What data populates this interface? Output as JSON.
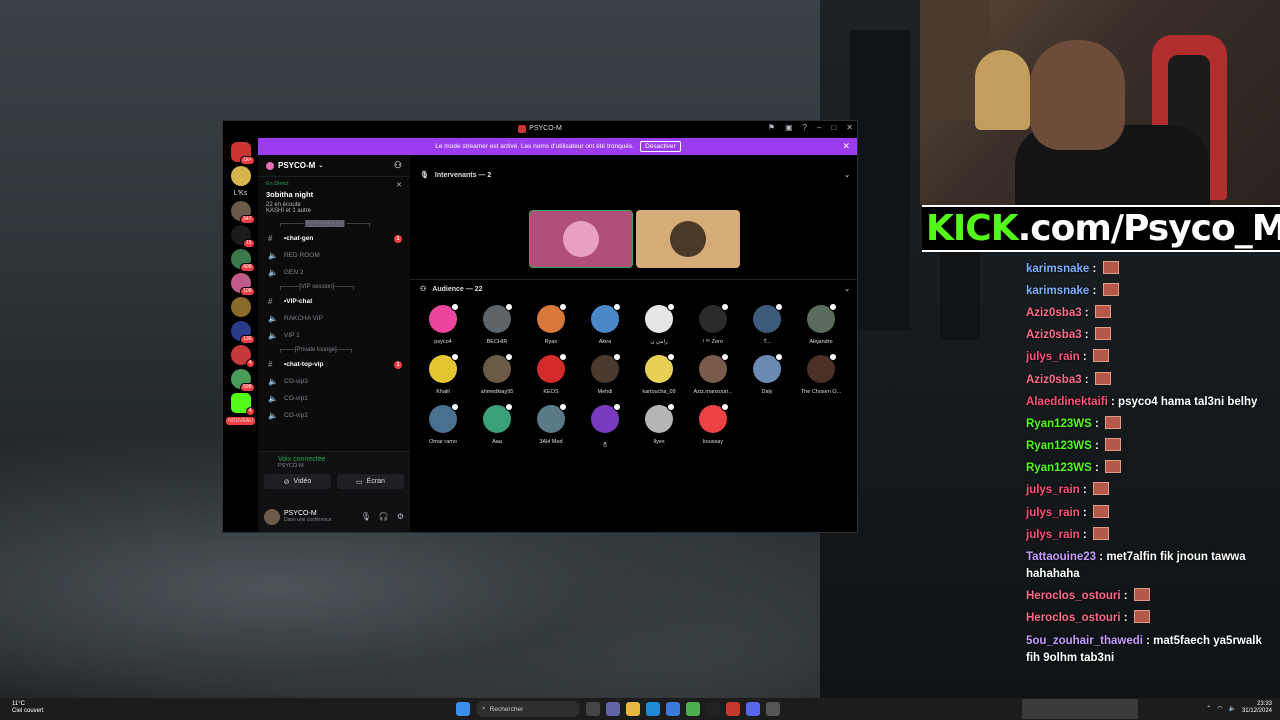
{
  "window": {
    "title": "PSYCO-M",
    "banner_text": "Le mode streamer est activé. Les noms d'utilisateur ont été tronqués.",
    "banner_button": "Désactiver"
  },
  "rail": {
    "lks_label": "L'Ks",
    "new_label": "NOUVEAU",
    "badges": [
      "1k+",
      "347",
      "15",
      "408",
      "108",
      "136",
      "4",
      "598",
      "4"
    ]
  },
  "server": {
    "name": "PSYCO-M",
    "event_live": "En Direct",
    "event_name": "3obitha night",
    "event_sub": "22 en écoute",
    "event_users": "KASHI et 1 autre",
    "categories": [
      {
        "label": "┌───── ▓▓▓▓▓▓▓▓▓ ─────┐",
        "channels": [
          {
            "icon": "#",
            "label": "•chat-gen",
            "unread": true,
            "badge": "1"
          },
          {
            "icon": "🔊",
            "label": "RED ROOM",
            "unread": false
          },
          {
            "icon": "🔊",
            "label": "GEN 2",
            "unread": false
          }
        ]
      },
      {
        "label": "┌────[VIP session]────┐",
        "channels": [
          {
            "icon": "#",
            "label": "•VIP-chat",
            "unread": true
          },
          {
            "icon": "🔊",
            "label": "RAKCHA VIP",
            "unread": false
          },
          {
            "icon": "🔊",
            "label": "VIP 1",
            "unread": false
          }
        ]
      },
      {
        "label": "┌───[Private lounge]───┐",
        "channels": [
          {
            "icon": "#",
            "label": "•chat-top-vip",
            "unread": true,
            "badge": "1"
          },
          {
            "icon": "🔊",
            "label": "CO-vip3",
            "unread": false
          },
          {
            "icon": "🔊",
            "label": "CO-vip1",
            "unread": false
          },
          {
            "icon": "🔊",
            "label": "CO-vip2",
            "unread": false
          }
        ]
      }
    ],
    "voice_connected": "Voix connectée",
    "voice_sub": "PSYCO-M",
    "video_btn": "Vidéo",
    "screen_btn": "Écran",
    "user_name": "PSYCO-M",
    "user_status": "Dans une conférence"
  },
  "stage": {
    "speakers_header": "Intervenants — 2",
    "audience_header": "Audience — 22",
    "audience": [
      {
        "name": "psyco4",
        "color": "#eb459e"
      },
      {
        "name": "BECHIR",
        "color": "#5f6468"
      },
      {
        "name": "Ryan",
        "color": "#d7783a"
      },
      {
        "name": "Akira",
        "color": "#4a87c9"
      },
      {
        "name": "رامي ن",
        "color": "#e6e6e6"
      },
      {
        "name": "! ᴵᵗˢ Zero",
        "color": "#2a2a2a"
      },
      {
        "name": "T...",
        "color": "#3d5a7a"
      },
      {
        "name": "Alejandro",
        "color": "#5b6c5c"
      },
      {
        "name": "",
        "color": "#000000"
      },
      {
        "name": "Khalil",
        "color": "#e5c531"
      },
      {
        "name": "ahmedkiay95",
        "color": "#6b5a46"
      },
      {
        "name": "KEOS",
        "color": "#d42a2a"
      },
      {
        "name": "Mehdi",
        "color": "#4a3a2e"
      },
      {
        "name": "kartoucha_09",
        "color": "#e8d056"
      },
      {
        "name": "Aziz.mansouri...",
        "color": "#7a5a4a"
      },
      {
        "name": "Daly",
        "color": "#6a8ab0"
      },
      {
        "name": "The Chosen O...",
        "color": "#4a3026"
      },
      {
        "name": "",
        "color": "#000000"
      },
      {
        "name": "Omar ramo",
        "color": "#4a7090"
      },
      {
        "name": "Aaa",
        "color": "#3aa07a"
      },
      {
        "name": "3Alé Med",
        "color": "#5a7a88"
      },
      {
        "name": "ｇ",
        "color": "#7a3ac0"
      },
      {
        "name": "Ilyes",
        "color": "#b5b5b5"
      },
      {
        "name": "koussay",
        "color": "#ed4245"
      }
    ]
  },
  "kick": {
    "prefix": "KICK",
    "suffix": ".com/Psyco_M"
  },
  "chat": [
    {
      "user": "karimsnake",
      "color": "#7ab0ff",
      "text": "",
      "emote": true
    },
    {
      "user": "karimsnake",
      "color": "#7ab0ff",
      "text": "",
      "emote": true
    },
    {
      "user": "Aziz0sba3",
      "color": "#ff6b8a",
      "text": "",
      "emote": true
    },
    {
      "user": "Aziz0sba3",
      "color": "#ff6b8a",
      "text": "",
      "emote": true
    },
    {
      "user": "julys_rain",
      "color": "#ff4f7a",
      "text": "",
      "emote": true
    },
    {
      "user": "Aziz0sba3",
      "color": "#ff6b8a",
      "text": "",
      "emote": true
    },
    {
      "user": "Alaeddinektaifi",
      "color": "#ff4f7a",
      "text": "psyco4 hama tal3ni belhy",
      "emote": false
    },
    {
      "user": "Ryan123WS",
      "color": "#53fc18",
      "text": "",
      "emote": true
    },
    {
      "user": "Ryan123WS",
      "color": "#53fc18",
      "text": "",
      "emote": true
    },
    {
      "user": "Ryan123WS",
      "color": "#53fc18",
      "text": "",
      "emote": true
    },
    {
      "user": "julys_rain",
      "color": "#ff4f7a",
      "text": "",
      "emote": true
    },
    {
      "user": "julys_rain",
      "color": "#ff4f7a",
      "text": "",
      "emote": true
    },
    {
      "user": "julys_rain",
      "color": "#ff4f7a",
      "text": "",
      "emote": true
    },
    {
      "user": "Tattaouine23",
      "color": "#c79bff",
      "text": "met7alfin fik jnoun tawwa hahahaha",
      "emote": false
    },
    {
      "user": "Heroclos_ostouri",
      "color": "#ff6b8a",
      "text": "",
      "emote": true
    },
    {
      "user": "Heroclos_ostouri",
      "color": "#ff6b8a",
      "text": "",
      "emote": true
    },
    {
      "user": "5ou_zouhair_thawedi",
      "color": "#c79bff",
      "text": "mat5faech ya5rwalk fih 9olhm tab3ni",
      "emote": false
    }
  ],
  "taskbar": {
    "weather_temp": "11°C",
    "weather_desc": "Ciel couvert",
    "search_placeholder": "Rechercher",
    "time": "23:33",
    "date": "31/12/2024"
  }
}
